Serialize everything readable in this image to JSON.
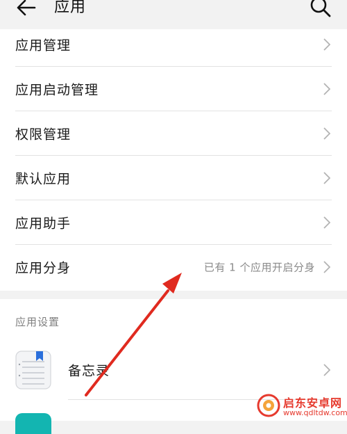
{
  "header": {
    "title": "应用",
    "back_icon": "back-arrow-icon",
    "search_icon": "search-icon"
  },
  "menu": {
    "items": [
      {
        "label": "应用管理",
        "value": ""
      },
      {
        "label": "应用启动管理",
        "value": ""
      },
      {
        "label": "权限管理",
        "value": ""
      },
      {
        "label": "默认应用",
        "value": ""
      },
      {
        "label": "应用助手",
        "value": ""
      },
      {
        "label": "应用分身",
        "value": "已有 1 个应用开启分身"
      }
    ]
  },
  "app_settings": {
    "section_title": "应用设置",
    "apps": [
      {
        "name": "备忘录",
        "icon": "memo-app-icon"
      }
    ]
  },
  "watermark": {
    "name": "启东安卓网",
    "url": "www.qdltdw.com"
  },
  "colors": {
    "background": "#f2f2f2",
    "card": "#ffffff",
    "annotation_arrow": "#e02a1f",
    "watermark": "#e63a2e",
    "second_app_icon": "#13b5b1"
  }
}
